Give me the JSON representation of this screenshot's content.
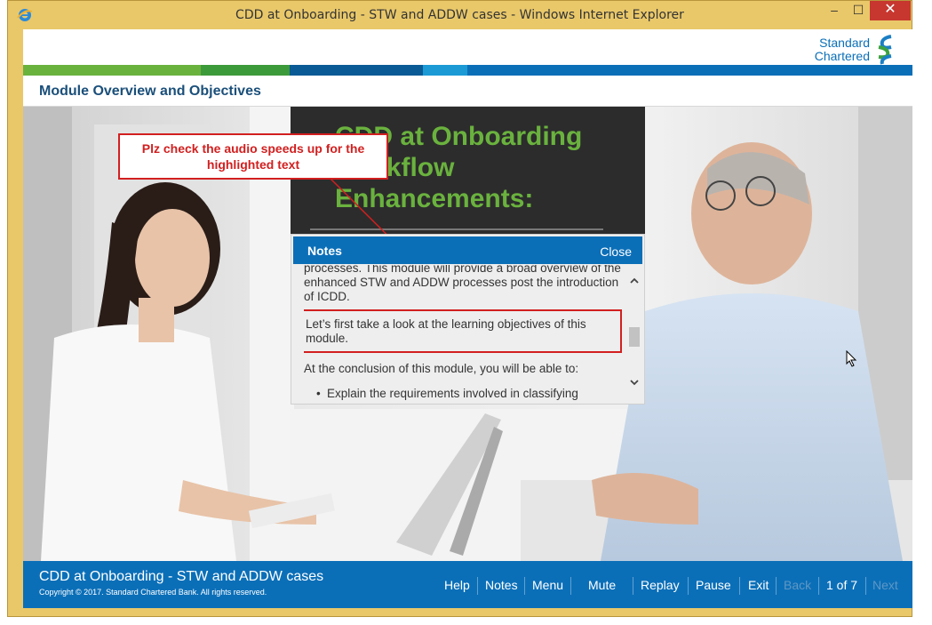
{
  "window": {
    "title": "CDD at Onboarding - STW and ADDW cases - Windows Internet Explorer",
    "min_icon": "–",
    "max_icon": "☐",
    "close_icon": "✕"
  },
  "brand": {
    "line1": "Standard",
    "line2": "Chartered"
  },
  "colors": {
    "blue": "#0b6fb8",
    "green_light": "#6ab23e",
    "green_dark": "#3d9a3a",
    "blue_dark": "#0a5a96",
    "cyan": "#1b9ad6",
    "callout_red": "#d21f1f"
  },
  "module": {
    "title": "Module Overview and Objectives"
  },
  "card": {
    "title": "CDD at Onboarding Workflow Enhancements:"
  },
  "callout": {
    "text": "Plz check the audio speeds up for the highlighted text"
  },
  "notes": {
    "title": "Notes",
    "close": "Close",
    "p1": "processes. This module will provide a broad overview of the enhanced STW and ADDW processes post the introduction of ICDD.",
    "p2": "Let’s first take a look at the learning objectives of this module.",
    "p3": "At the conclusion of this module, you will be able to:",
    "bullet1": "Explain the requirements involved in classifying"
  },
  "footer": {
    "course_title": "CDD at Onboarding - STW and ADDW cases",
    "copyright": "Copyright © 2017. Standard Chartered Bank. All rights reserved.",
    "nav": {
      "help": "Help",
      "notes": "Notes",
      "menu": "Menu",
      "mute": "Mute",
      "replay": "Replay",
      "pause": "Pause",
      "exit": "Exit",
      "back": "Back",
      "page": "1 of 7",
      "next": "Next"
    }
  }
}
